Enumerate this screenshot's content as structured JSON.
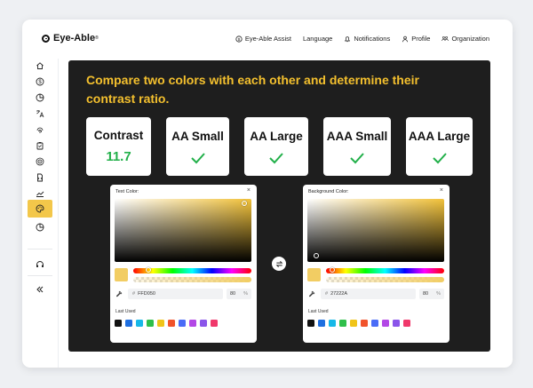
{
  "app": {
    "name": "Eye-Able",
    "trademark": "®"
  },
  "topnav": [
    {
      "label": "Eye-Able Assist",
      "icon": "dollar-circle-icon"
    },
    {
      "label": "Language",
      "icon": ""
    },
    {
      "label": "Notifications",
      "icon": "bell-icon"
    },
    {
      "label": "Profile",
      "icon": "user-icon"
    },
    {
      "label": "Organization",
      "icon": "team-icon"
    }
  ],
  "sidebar": {
    "items": [
      {
        "icon": "home-icon"
      },
      {
        "icon": "dollar-icon"
      },
      {
        "icon": "pie-chart-icon"
      },
      {
        "icon": "translate-icon"
      },
      {
        "icon": "fingerprint-icon"
      },
      {
        "icon": "clipboard-icon"
      },
      {
        "icon": "target-icon"
      },
      {
        "icon": "document-code-icon"
      },
      {
        "icon": "trend-chart-icon"
      },
      {
        "icon": "palette-icon",
        "active": true
      },
      {
        "icon": "pie-chart-icon"
      },
      {
        "icon": "headset-icon"
      },
      {
        "icon": "collapse-icon"
      }
    ],
    "active_color": "#f3c74a"
  },
  "main": {
    "headline": "Compare two colors with each other and determine their contrast ratio.",
    "headline_color": "#f4c02e",
    "background_color": "#1e1e1e"
  },
  "results": {
    "contrast_label": "Contrast",
    "contrast_value": "11.7",
    "aa_small_label": "AA Small",
    "aa_large_label": "AA Large",
    "aaa_small_label": "AAA Small",
    "aaa_large_label": "AAA Large",
    "pass_color": "#22b04a"
  },
  "text_picker": {
    "title": "Text Color:",
    "hex": "FFD050",
    "alpha": "80",
    "alpha_unit": "%",
    "swatch_color": "#f2cd63",
    "last_used_label": "Last Used"
  },
  "background_picker": {
    "title": "Background Color:",
    "hex": "27222A",
    "alpha": "80",
    "alpha_unit": "%",
    "swatch_color": "#f2cd63",
    "last_used_label": "Last Used"
  },
  "recent_colors_text": [
    "#111111",
    "#1e6fe0",
    "#17b8e8",
    "#2fbf4a",
    "#f0c419",
    "#f1532b",
    "#4a6cf7",
    "#b347e6",
    "#8a55ea",
    "#f0386b"
  ],
  "recent_colors_bg": [
    "#111111",
    "#1e6fe0",
    "#17b8e8",
    "#2fbf4a",
    "#f0c419",
    "#f1532b",
    "#4a6cf7",
    "#b347e6",
    "#8a55ea",
    "#f0386b"
  ],
  "close_glyph": "×"
}
